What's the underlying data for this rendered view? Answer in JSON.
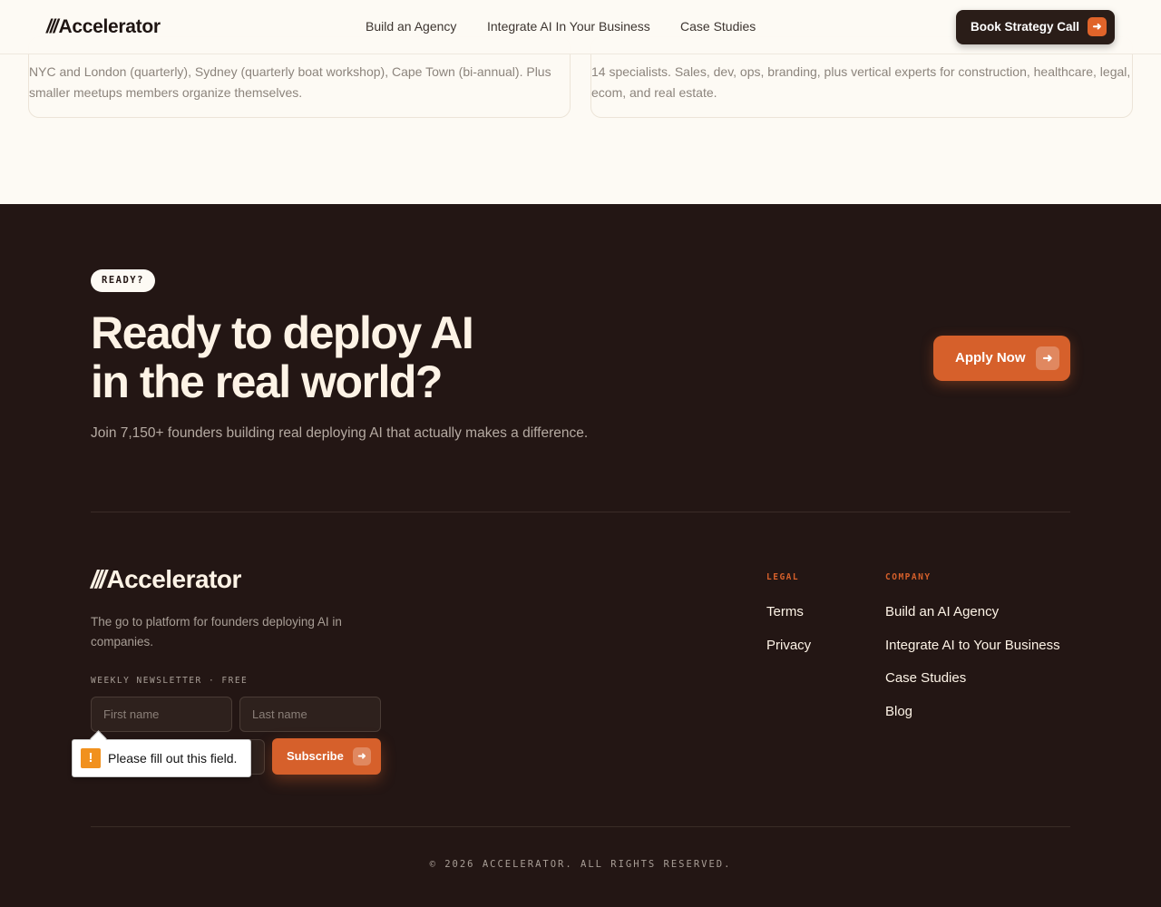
{
  "header": {
    "logo_slashes": "///",
    "logo_text": "Accelerator",
    "nav": [
      "Build an Agency",
      "Integrate AI In Your Business",
      "Case Studies"
    ],
    "cta_label": "Book Strategy Call",
    "cta_icon": "arrow-right-icon"
  },
  "cards": [
    {
      "text": "NYC and London (quarterly), Sydney (quarterly boat workshop), Cape Town (bi-annual). Plus smaller meetups members organize themselves."
    },
    {
      "text": "14 specialists. Sales, dev, ops, branding, plus vertical experts for construction, healthcare, legal, ecom, and real estate."
    }
  ],
  "cta_section": {
    "pill": "READY?",
    "headline_line1": "Ready to deploy AI",
    "headline_line2": "in the real world?",
    "subtext": "Join 7,150+ founders building real deploying AI that actually makes a difference.",
    "button_label": "Apply Now"
  },
  "footer": {
    "logo_slashes": "///",
    "logo_text": "Accelerator",
    "tagline": "The go to platform for founders deploying AI in companies.",
    "newsletter_label": "WEEKLY NEWSLETTER · FREE",
    "first_name_placeholder": "First name",
    "last_name_placeholder": "Last name",
    "subscribe_label": "Subscribe",
    "validation_message": "Please fill out this field.",
    "legal_heading": "LEGAL",
    "legal_links": [
      "Terms",
      "Privacy"
    ],
    "company_heading": "COMPANY",
    "company_links": [
      "Build an AI Agency",
      "Integrate AI to Your Business",
      "Case Studies",
      "Blog"
    ],
    "copyright": "© 2026 ACCELERATOR. ALL RIGHTS RESERVED."
  },
  "colors": {
    "accent": "#d6602b",
    "dark_bg": "#231614",
    "light_bg": "#fdfaf4"
  }
}
